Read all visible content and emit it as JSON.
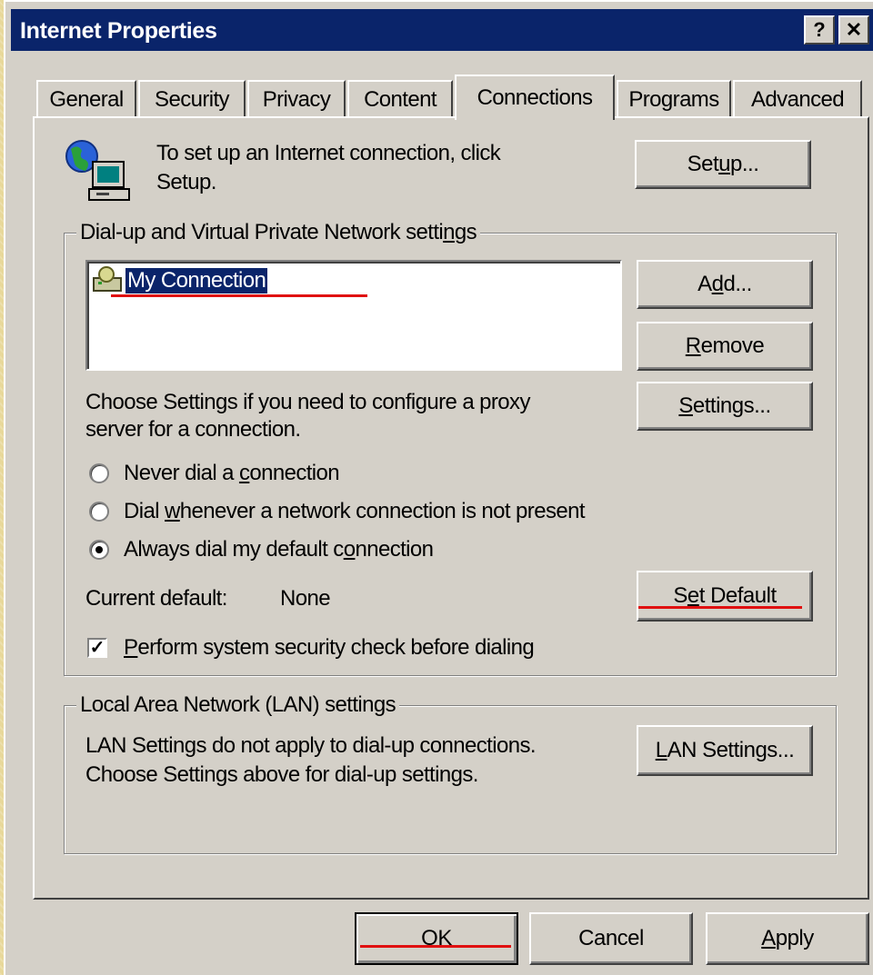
{
  "window": {
    "title": "Internet Properties",
    "help_glyph": "?",
    "close_glyph": "✕"
  },
  "tabs": [
    {
      "label": "General"
    },
    {
      "label": "Security"
    },
    {
      "label": "Privacy"
    },
    {
      "label": "Content"
    },
    {
      "label": "Connections",
      "active": true
    },
    {
      "label": "Programs"
    },
    {
      "label": "Advanced"
    }
  ],
  "setup": {
    "text_line1": "To set up an Internet connection, click",
    "text_line2": "Setup.",
    "button": "Setup..."
  },
  "dialup": {
    "legend": "Dial-up and Virtual Private Network settings",
    "connections": [
      "My Connection"
    ],
    "add": "Add...",
    "remove": "Remove",
    "settings": "Settings...",
    "settings_text_line1": "Choose Settings if you need to configure a proxy",
    "settings_text_line2": "server for a connection.",
    "radio_never": "Never dial a connection",
    "radio_whenever": "Dial whenever a network connection is not present",
    "radio_always": "Always dial my default connection",
    "selected_radio": "always",
    "current_default_label": "Current default:",
    "current_default_value": "None",
    "set_default": "Set Default",
    "security_check": "Perform system security check before dialing",
    "security_check_checked": true
  },
  "lan": {
    "legend": "Local Area Network (LAN) settings",
    "text_line1": "LAN Settings do not apply to dial-up connections.",
    "text_line2": "Choose Settings above for dial-up settings.",
    "button": "LAN Settings..."
  },
  "footer": {
    "ok": "OK",
    "cancel": "Cancel",
    "apply": "Apply"
  },
  "colors": {
    "titlebar": "#0a246a",
    "face": "#d4d0c8",
    "annotation": "#e01010",
    "desktop": "#e8d89a"
  }
}
